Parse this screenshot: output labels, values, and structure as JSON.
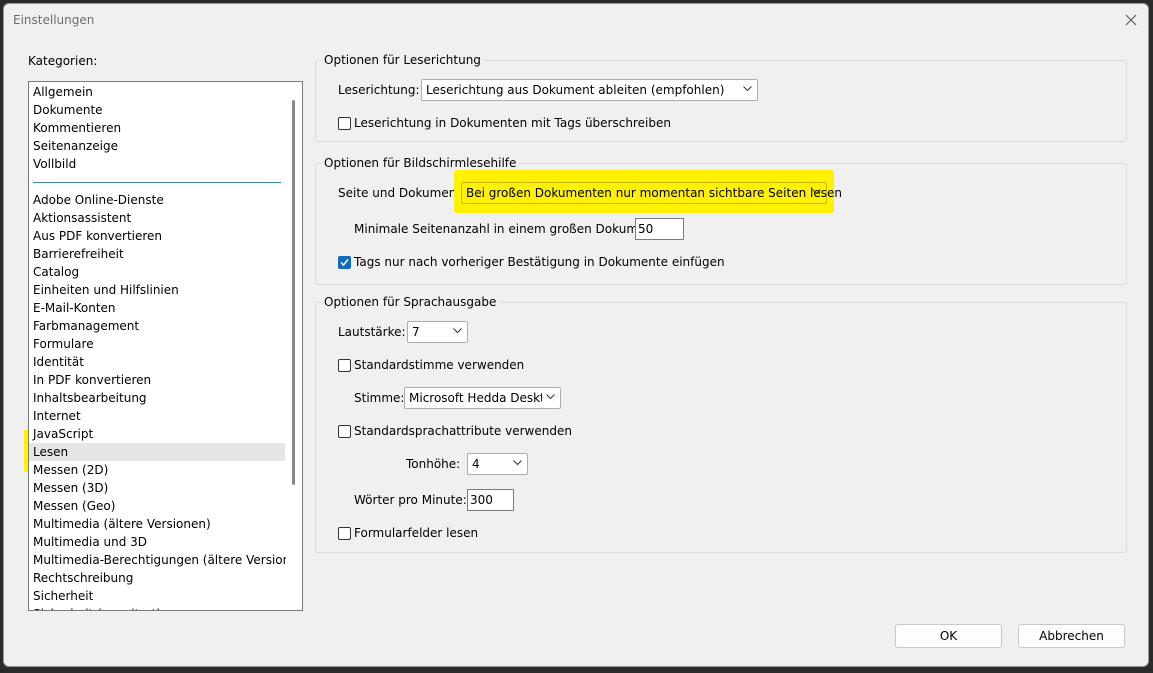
{
  "window": {
    "title": "Einstellungen"
  },
  "categories": {
    "label": "Kategorien:",
    "group1": [
      "Allgemein",
      "Dokumente",
      "Kommentieren",
      "Seitenanzeige",
      "Vollbild"
    ],
    "group2": [
      "Adobe Online-Dienste",
      "Aktionsassistent",
      "Aus PDF konvertieren",
      "Barrierefreiheit",
      "Catalog",
      "Einheiten und Hilfslinien",
      "E-Mail-Konten",
      "Farbmanagement",
      "Formulare",
      "Identität",
      "In PDF konvertieren",
      "Inhaltsbearbeitung",
      "Internet",
      "JavaScript",
      "Lesen",
      "Messen (2D)",
      "Messen (3D)",
      "Messen (Geo)",
      "Multimedia (ältere Versionen)",
      "Multimedia und 3D",
      "Multimedia-Berechtigungen (ältere Versionen)",
      "Rechtschreibung",
      "Sicherheit",
      "Sicherheit (erweitert)"
    ],
    "selected": "Lesen"
  },
  "reading_order": {
    "title": "Optionen für Leserichtung",
    "label": "Leserichtung:",
    "value": "Leserichtung aus Dokument ableiten (empfohlen)",
    "override_label": "Leserichtung in Dokumenten mit Tags überschreiben",
    "override_checked": false
  },
  "screen_reader": {
    "title": "Optionen für Bildschirmlesehilfe",
    "page_label": "Seite und Dokument:",
    "page_value": "Bei großen Dokumenten nur momentan sichtbare Seiten lesen",
    "min_pages_label": "Minimale Seitenanzahl in einem großen Dokument:",
    "min_pages_value": "50",
    "tags_label": "Tags nur nach vorheriger Bestätigung in Dokumente einfügen",
    "tags_checked": true
  },
  "speech": {
    "title": "Optionen für Sprachausgabe",
    "volume_label": "Lautstärke:",
    "volume_value": "7",
    "default_voice_label": "Standardstimme verwenden",
    "default_voice_checked": false,
    "voice_label": "Stimme:",
    "voice_value": "Microsoft Hedda Desktop - German",
    "default_attr_label": "Standardsprachattribute verwenden",
    "default_attr_checked": false,
    "pitch_label": "Tonhöhe:",
    "pitch_value": "4",
    "wpm_label": "Wörter pro Minute:",
    "wpm_value": "300",
    "form_fields_label": "Formularfelder lesen",
    "form_fields_checked": false
  },
  "buttons": {
    "ok": "OK",
    "cancel": "Abbrechen"
  },
  "colors": {
    "highlight": "#fff200",
    "checkbox_checked": "#0f6cbd",
    "separator": "#3a8ba0"
  }
}
